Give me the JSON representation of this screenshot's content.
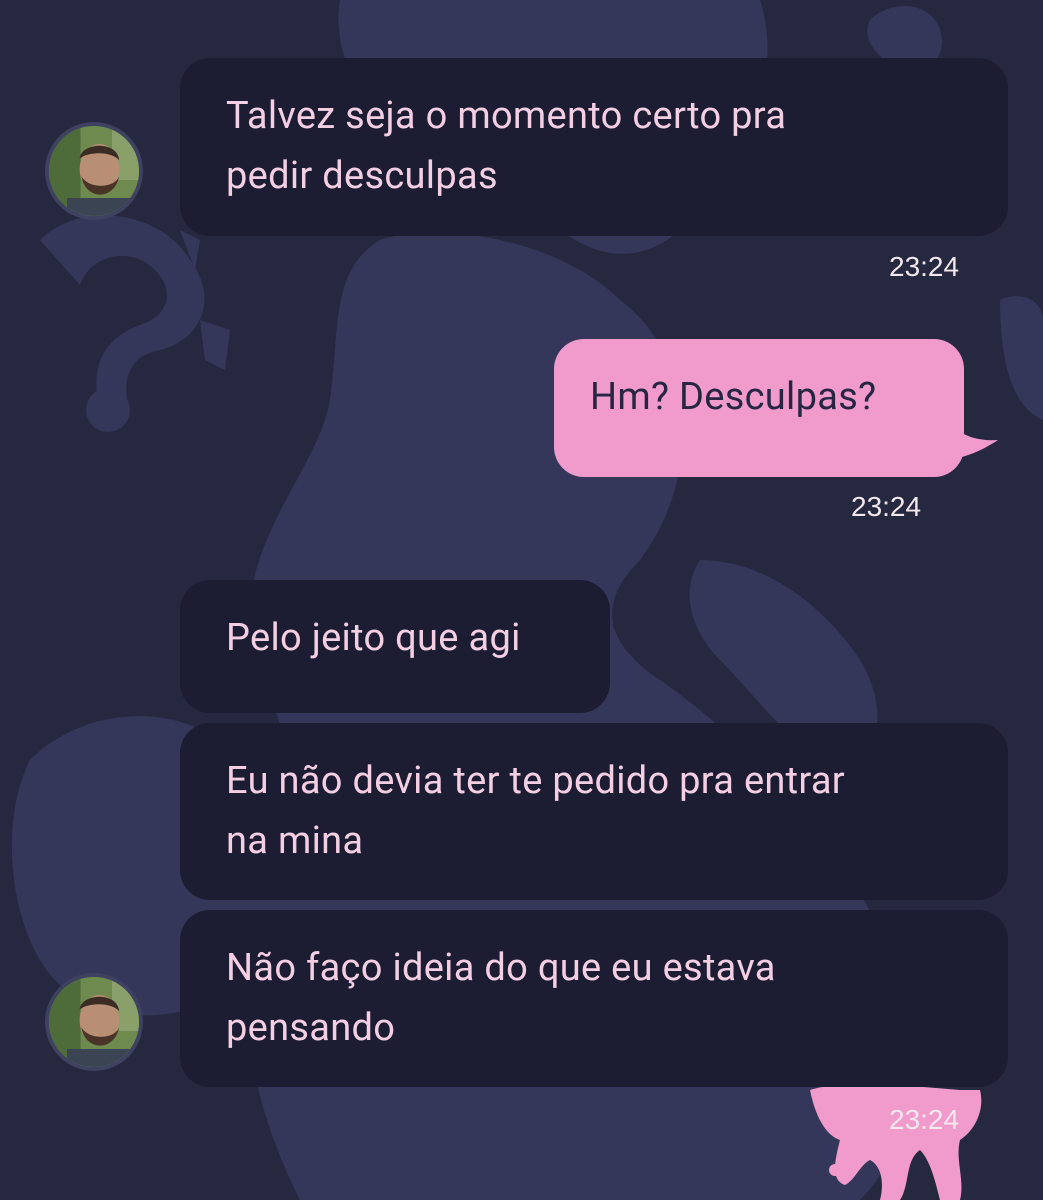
{
  "conversation": {
    "messages": [
      {
        "direction": "incoming",
        "text": "Talvez seja o momento certo pra\npedir desculpas",
        "time": "23:24"
      },
      {
        "direction": "outgoing",
        "text": "Hm? Desculpas?",
        "time": "23:24"
      },
      {
        "direction": "incoming",
        "text": "Pelo jeito que agi"
      },
      {
        "direction": "incoming",
        "text": "Eu não devia ter te pedido pra entrar\nna mina"
      },
      {
        "direction": "incoming",
        "text": "Não faço ideia do que eu estava\npensando",
        "time": "23:24"
      }
    ]
  },
  "icons": {
    "avatar": "contact-avatar-photo"
  },
  "colors": {
    "background": "#262840",
    "background_art": "#34375a",
    "incoming_bubble": "#1c1d33",
    "incoming_text": "#f4cfe3",
    "outgoing_bubble": "#f19bcd",
    "outgoing_text": "#272642",
    "pink_drip": "#f19bcd"
  }
}
